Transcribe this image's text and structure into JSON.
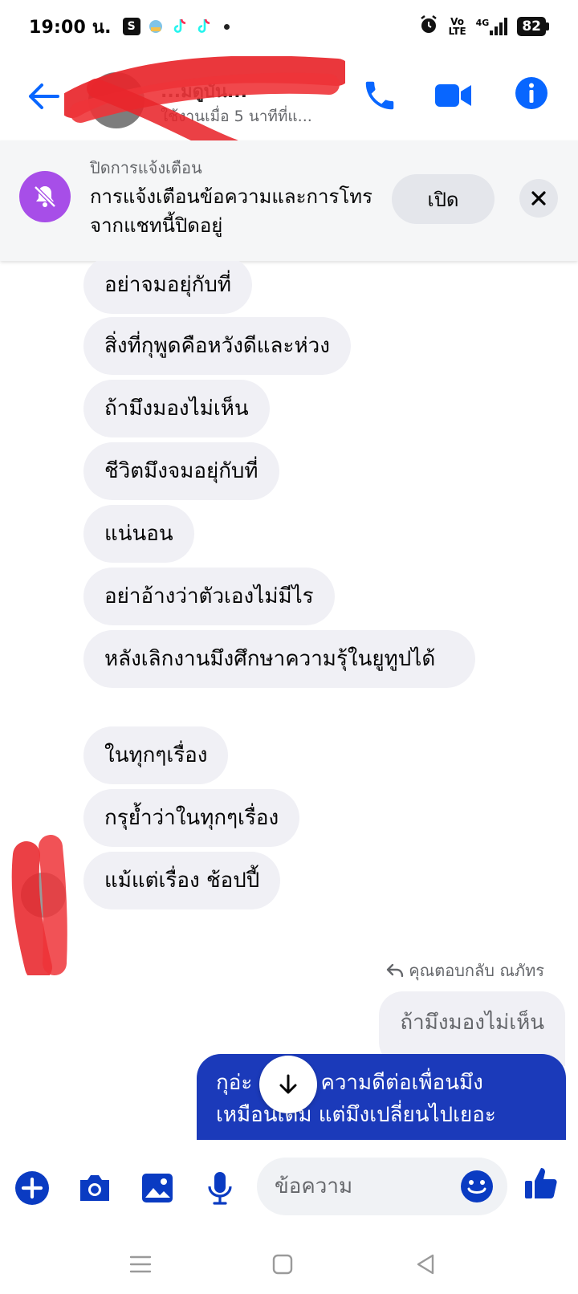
{
  "status_bar": {
    "time": "19:00 น.",
    "network": "4G",
    "volte_top": "Vo",
    "volte_bottom": "LTE",
    "battery": "82"
  },
  "header": {
    "contact_name": "...มดูบัน...",
    "last_seen": "ใช้งานเมื่อ 5 นาทีที่แ..."
  },
  "mute_banner": {
    "title": "ปิดการแจ้งเตือน",
    "description": "การแจ้งเตือนข้อความและการโทรจากแชทนี้ปิดอยู่",
    "open_label": "เปิด"
  },
  "messages": {
    "incoming": [
      "อย่าจมอยุ่กับที่",
      "สิ่งที่กุพูดคือหวังดีและห่วง",
      "ถ้ามึงมองไม่เห็น",
      "ชีวิตมึงจมอยุ่กับที่",
      "แน่นอน",
      "อย่าอ้างว่าตัวเองไม่มีไร",
      "หลังเลิกงานมึงศึกษาความรุ้ในยูทูปได้",
      "ในทุกๆเรื่อง",
      "กรุย้ำว่าในทุกๆเรื่อง",
      "แม้แต่เรื่อง ช้อปปี้"
    ],
    "reply_indicator": "คุณตอบกลับ ณภัทร",
    "reply_quote": "ถ้ามึงมองไม่เห็น",
    "outgoing_text": "กุอ่ะ ...เห็น ความดีต่อเพื่อนมึง เหมือนเดิม แต่มึงเปลี่ยนไปเยอะ"
  },
  "composer": {
    "placeholder": "ข้อความ"
  },
  "colors": {
    "messenger_blue": "#0866ff",
    "outgoing_bubble": "#1b3aba",
    "mute_purple": "#a74ee8",
    "incoming_bubble": "#f0f0f5",
    "composer_blue": "#0a3bc2"
  }
}
